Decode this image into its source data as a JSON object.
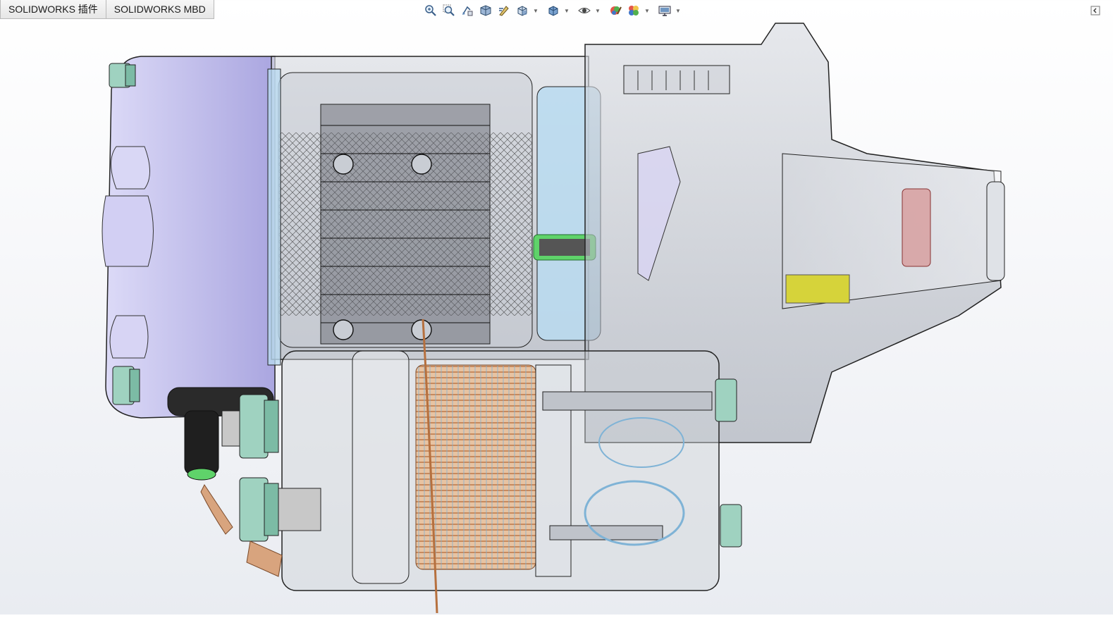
{
  "tabs": [
    {
      "label": "SOLIDWORKS 插件"
    },
    {
      "label": "SOLIDWORKS MBD"
    }
  ],
  "heads_up_toolbar": [
    {
      "icon": "zoom-to-fit-icon",
      "dropdown": false
    },
    {
      "icon": "zoom-to-area-icon",
      "dropdown": false
    },
    {
      "icon": "previous-view-icon",
      "dropdown": false
    },
    {
      "icon": "section-view-icon",
      "dropdown": false
    },
    {
      "icon": "dynamic-annotation-icon",
      "dropdown": false
    },
    {
      "icon": "view-orientation-icon",
      "dropdown": true
    },
    {
      "icon": "display-style-icon",
      "dropdown": true
    },
    {
      "icon": "hide-show-items-icon",
      "dropdown": true
    },
    {
      "icon": "edit-appearance-icon",
      "dropdown": false
    },
    {
      "icon": "apply-scene-icon",
      "dropdown": true
    },
    {
      "icon": "view-settings-icon",
      "dropdown": true
    }
  ],
  "colors": {
    "housing_lavender": "#c9c6f0",
    "transparent_gray": "#b8bcc4",
    "copper_coil": "#d8a47e",
    "hardware_teal": "#8fc9b6",
    "bearing_yellow": "#d6d33a",
    "indicator_green": "#5fd36a",
    "light_blue_plate": "#b9daf0"
  }
}
